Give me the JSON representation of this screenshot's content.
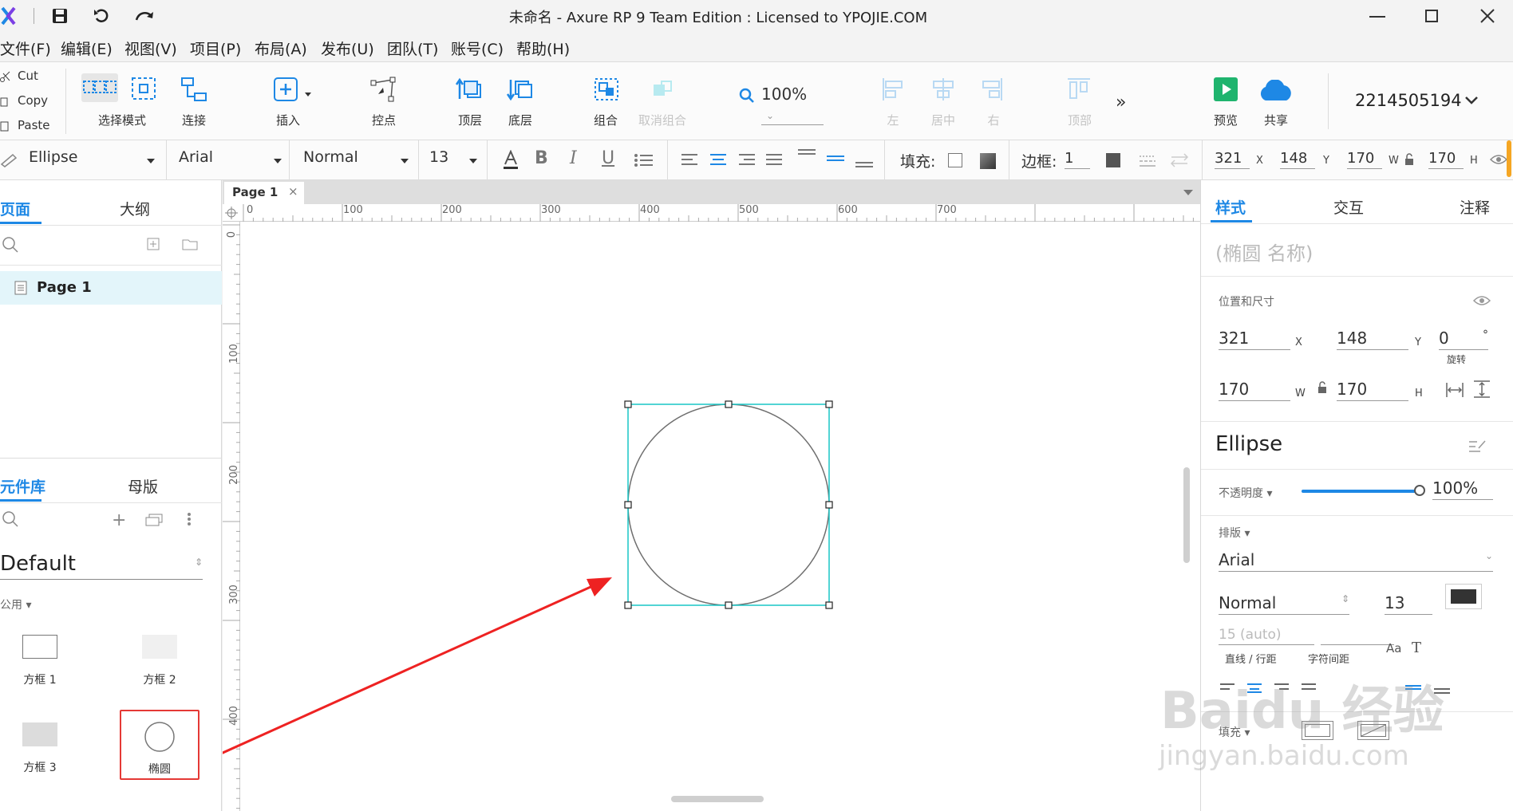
{
  "window": {
    "title": "未命名 - Axure RP 9 Team Edition : Licensed to YPOJIE.COM"
  },
  "menu": [
    "文件(F)",
    "编辑(E)",
    "视图(V)",
    "项目(P)",
    "布局(A)",
    "发布(U)",
    "团队(T)",
    "账号(C)",
    "帮助(H)"
  ],
  "clipboard": {
    "cut": "Cut",
    "copy": "Copy",
    "paste": "Paste"
  },
  "toolbar": {
    "select_mode": "选择模式",
    "connect": "连接",
    "insert": "插入",
    "points": "控点",
    "top": "顶层",
    "bottom": "底层",
    "group": "组合",
    "ungroup": "取消组合",
    "zoom": "100%",
    "align_left": "左",
    "align_center": "居中",
    "align_right": "右",
    "align_top": "顶部",
    "preview": "预览",
    "share": "共享",
    "account": "2214505194"
  },
  "format": {
    "shape": "Ellipse",
    "font": "Arial",
    "weight": "Normal",
    "size": "13",
    "fill_label": "填充:",
    "border_label": "边框:",
    "border_value": "1",
    "x": "321",
    "y": "148",
    "w": "170",
    "h": "170",
    "x_unit": "X",
    "y_unit": "Y",
    "w_unit": "W",
    "h_unit": "H"
  },
  "left": {
    "tabs": [
      "页面",
      "大纲"
    ],
    "pages": [
      "Page 1"
    ],
    "lib_tabs": [
      "元件库",
      "母版"
    ],
    "library": "Default",
    "group": "公用 ▾",
    "widgets": [
      "方框 1",
      "方框 2",
      "方框 3",
      "椭圆"
    ]
  },
  "canvas": {
    "tab": "Page 1",
    "ruler_h": [
      "0",
      "100",
      "200",
      "300",
      "400",
      "500",
      "600",
      "700"
    ],
    "ruler_v": [
      "0",
      "100",
      "200",
      "300",
      "400"
    ]
  },
  "right": {
    "tabs": [
      "样式",
      "交互",
      "注释"
    ],
    "name_placeholder": "(椭圆 名称)",
    "pos_label": "位置和尺寸",
    "x": "321",
    "y": "148",
    "rotate": "0",
    "rotate_unit": "°",
    "rotate_label": "旋转",
    "w": "170",
    "h": "170",
    "x_unit": "X",
    "y_unit": "Y",
    "w_unit": "W",
    "h_unit": "H",
    "style_name": "Ellipse",
    "opacity_label": "不透明度 ▾",
    "opacity": "100%",
    "opacity_value": 1.0,
    "typography_label": "排版 ▾",
    "font": "Arial",
    "weight": "Normal",
    "size": "13",
    "line_height": "15 (auto)",
    "line_height_label": "直线 / 行距",
    "char_spacing_label": "字符间距",
    "fill_label": "填充 ▾"
  },
  "watermark": {
    "brand": "Baidu 经验",
    "url": "jingyan.baidu.com"
  },
  "colors": {
    "accent": "#1e88e5",
    "selection": "#18c5c5",
    "arrow": "#ee2222",
    "highlight": "#e53935"
  }
}
